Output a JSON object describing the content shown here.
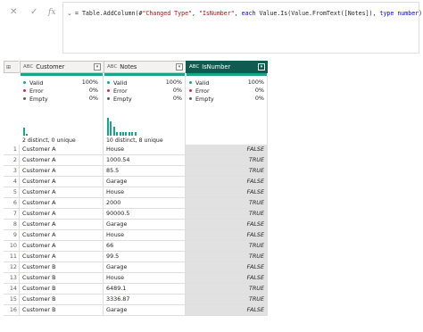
{
  "formula_bar": {
    "cancel_icon": "close-icon",
    "commit_icon": "check-icon",
    "fx_label": "fx",
    "collapse_icon": "chevron-icon",
    "formula_prefix": "= Table.AddColumn(#",
    "formula_str1": "\"Changed Type\"",
    "formula_sep": ", ",
    "formula_str2": "\"IsNumber\"",
    "formula_sep2": ", ",
    "formula_kw": "each",
    "formula_mid": " Value.Is(Value.FromText([Notes]), ",
    "formula_kw2": "type number",
    "formula_end": ")"
  },
  "grid": {
    "corner_label": "⊞",
    "columns": [
      {
        "type_icon": "ABC",
        "name": "Customer",
        "selected": false
      },
      {
        "type_icon": "ABC",
        "name": "Notes",
        "selected": false
      },
      {
        "type_icon": "ABC",
        "name": "IsNumber",
        "selected": true
      }
    ],
    "profiles": [
      {
        "valid_label": "Valid",
        "valid": "100%",
        "error_label": "Error",
        "error": "0%",
        "empty_label": "Empty",
        "empty": "0%",
        "distinct": "2 distinct, 0 unique",
        "hist": [
          15,
          4
        ]
      },
      {
        "valid_label": "Valid",
        "valid": "100%",
        "error_label": "Error",
        "error": "0%",
        "empty_label": "Empty",
        "empty": "0%",
        "distinct": "10 distinct, 8 unique",
        "hist": [
          34,
          28,
          17,
          6,
          6,
          6,
          6,
          6,
          6,
          6
        ]
      },
      {
        "valid_label": "Valid",
        "valid": "100%",
        "error_label": "Error",
        "error": "0%",
        "empty_label": "Empty",
        "empty": "0%",
        "distinct": "",
        "hist": []
      }
    ],
    "rows": [
      [
        "1",
        "Customer A",
        "House",
        "FALSE"
      ],
      [
        "2",
        "Customer A",
        "1000.54",
        "TRUE"
      ],
      [
        "3",
        "Customer A",
        "85.5",
        "TRUE"
      ],
      [
        "4",
        "Customer A",
        "Garage",
        "FALSE"
      ],
      [
        "5",
        "Customer A",
        "House",
        "FALSE"
      ],
      [
        "6",
        "Customer A",
        "2000",
        "TRUE"
      ],
      [
        "7",
        "Customer A",
        "90000.5",
        "TRUE"
      ],
      [
        "8",
        "Customer A",
        "Garage",
        "FALSE"
      ],
      [
        "9",
        "Customer A",
        "House",
        "FALSE"
      ],
      [
        "10",
        "Customer A",
        "66",
        "TRUE"
      ],
      [
        "11",
        "Customer A",
        "99.5",
        "TRUE"
      ],
      [
        "12",
        "Customer B",
        "Garage",
        "FALSE"
      ],
      [
        "13",
        "Customer B",
        "House",
        "FALSE"
      ],
      [
        "14",
        "Customer B",
        "6489.1",
        "TRUE"
      ],
      [
        "15",
        "Customer B",
        "3336.87",
        "TRUE"
      ],
      [
        "16",
        "Customer B",
        "Garage",
        "FALSE"
      ]
    ]
  },
  "colors": {
    "valid": "#18a58a",
    "error": "#c4314b",
    "empty": "#605e5c",
    "selected_header": "#0f5b4f"
  }
}
